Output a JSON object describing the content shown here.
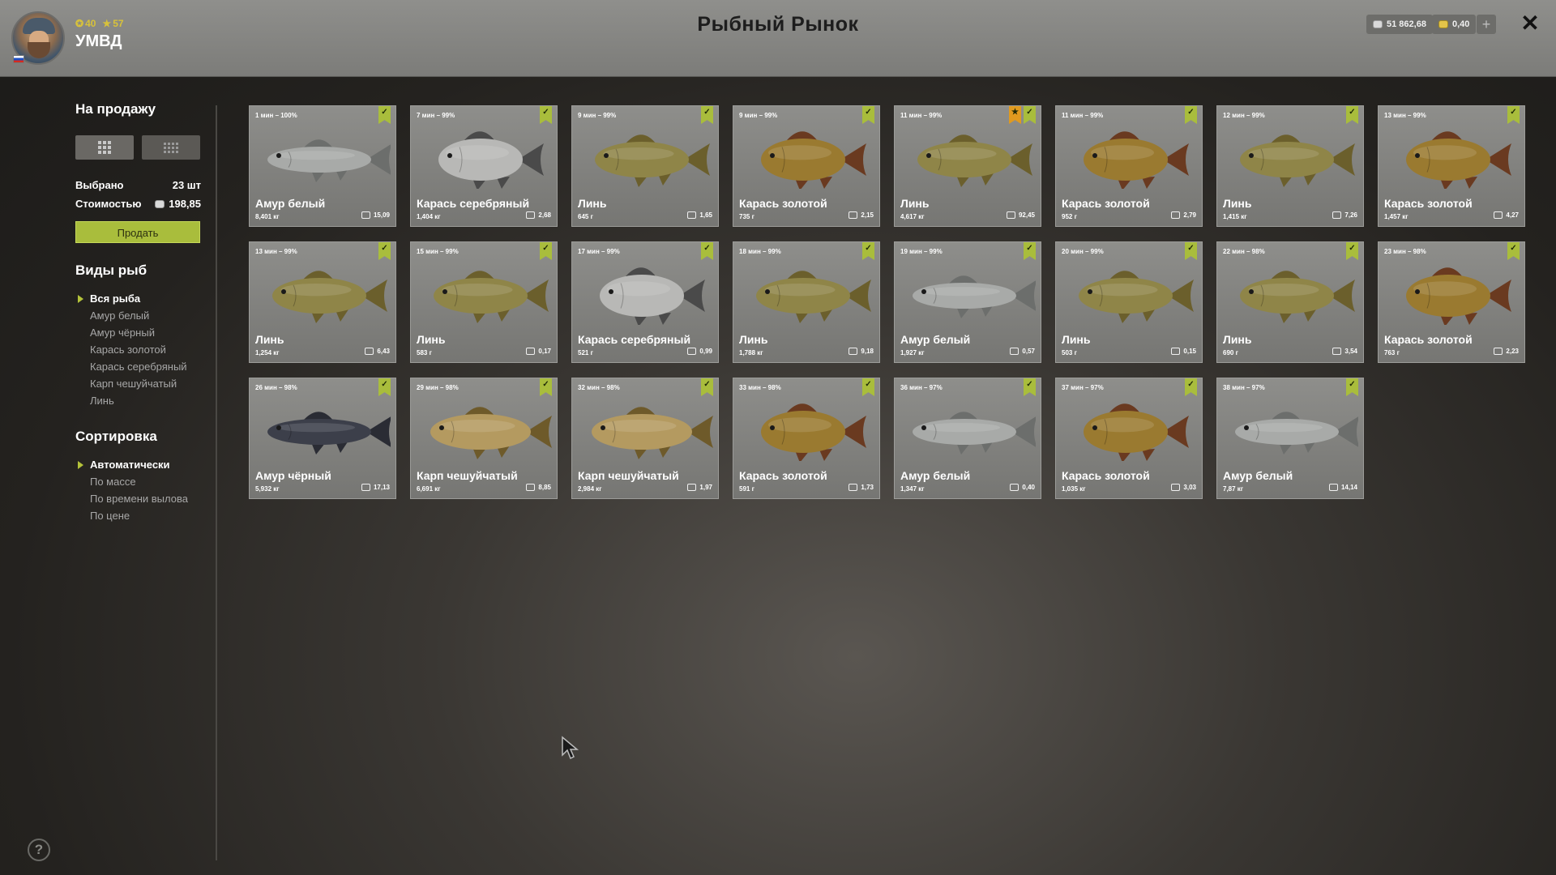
{
  "header": {
    "title": "Рыбный Рынок",
    "player": {
      "name": "УМВД",
      "stat1": "40",
      "stat2": "57"
    },
    "silver": "51 862,68",
    "gold": "0,40",
    "plus_label": "+",
    "close_label": "✕"
  },
  "sidebar": {
    "for_sale_title": "На продажу",
    "selected_label": "Выбрано",
    "selected_value": "23 шт",
    "cost_label": "Стоимостью",
    "cost_value": "198,85",
    "sell_label": "Продать",
    "species_title": "Виды рыб",
    "species": [
      {
        "label": "Вся рыба",
        "active": true
      },
      {
        "label": "Амур белый",
        "active": false
      },
      {
        "label": "Амур чёрный",
        "active": false
      },
      {
        "label": "Карась золотой",
        "active": false
      },
      {
        "label": "Карась серебряный",
        "active": false
      },
      {
        "label": "Карп чешуйчатый",
        "active": false
      },
      {
        "label": "Линь",
        "active": false
      }
    ],
    "sort_title": "Сортировка",
    "sort": [
      {
        "label": "Автоматически",
        "active": true
      },
      {
        "label": "По массе",
        "active": false
      },
      {
        "label": "По времени вылова",
        "active": false
      },
      {
        "label": "По цене",
        "active": false
      }
    ]
  },
  "help_label": "?",
  "fish": [
    {
      "time": "1 мин – 100%",
      "name": "Амур белый",
      "weight": "8,401 кг",
      "price": "15,09",
      "star": false
    },
    {
      "time": "7 мин – 99%",
      "name": "Карась серебряный",
      "weight": "1,404 кг",
      "price": "2,68",
      "star": false
    },
    {
      "time": "9 мин – 99%",
      "name": "Линь",
      "weight": "645 г",
      "price": "1,65",
      "star": false
    },
    {
      "time": "9 мин – 99%",
      "name": "Карась золотой",
      "weight": "735 г",
      "price": "2,15",
      "star": false
    },
    {
      "time": "11 мин – 99%",
      "name": "Линь",
      "weight": "4,617 кг",
      "price": "92,45",
      "star": true
    },
    {
      "time": "11 мин – 99%",
      "name": "Карась золотой",
      "weight": "952 г",
      "price": "2,79",
      "star": false
    },
    {
      "time": "12 мин – 99%",
      "name": "Линь",
      "weight": "1,415 кг",
      "price": "7,26",
      "star": false
    },
    {
      "time": "13 мин – 99%",
      "name": "Карась золотой",
      "weight": "1,457 кг",
      "price": "4,27",
      "star": false
    },
    {
      "time": "13 мин – 99%",
      "name": "Линь",
      "weight": "1,254 кг",
      "price": "6,43",
      "star": false
    },
    {
      "time": "15 мин – 99%",
      "name": "Линь",
      "weight": "583 г",
      "price": "0,17",
      "star": false
    },
    {
      "time": "17 мин – 99%",
      "name": "Карась серебряный",
      "weight": "521 г",
      "price": "0,99",
      "star": false
    },
    {
      "time": "18 мин – 99%",
      "name": "Линь",
      "weight": "1,788 кг",
      "price": "9,18",
      "star": false
    },
    {
      "time": "19 мин – 99%",
      "name": "Амур белый",
      "weight": "1,927 кг",
      "price": "0,57",
      "star": false
    },
    {
      "time": "20 мин – 99%",
      "name": "Линь",
      "weight": "503 г",
      "price": "0,15",
      "star": false
    },
    {
      "time": "22 мин – 98%",
      "name": "Линь",
      "weight": "690 г",
      "price": "3,54",
      "star": false
    },
    {
      "time": "23 мин – 98%",
      "name": "Карась золотой",
      "weight": "763 г",
      "price": "2,23",
      "star": false
    },
    {
      "time": "26 мин – 98%",
      "name": "Амур чёрный",
      "weight": "5,932 кг",
      "price": "17,13",
      "star": false
    },
    {
      "time": "29 мин – 98%",
      "name": "Карп чешуйчатый",
      "weight": "6,691 кг",
      "price": "8,85",
      "star": false
    },
    {
      "time": "32 мин – 98%",
      "name": "Карп чешуйчатый",
      "weight": "2,984 кг",
      "price": "1,97",
      "star": false
    },
    {
      "time": "33 мин – 98%",
      "name": "Карась золотой",
      "weight": "591 г",
      "price": "1,73",
      "star": false
    },
    {
      "time": "36 мин – 97%",
      "name": "Амур белый",
      "weight": "1,347 кг",
      "price": "0,40",
      "star": false
    },
    {
      "time": "37 мин – 97%",
      "name": "Карась золотой",
      "weight": "1,035 кг",
      "price": "3,03",
      "star": false
    },
    {
      "time": "38 мин – 97%",
      "name": "Амур белый",
      "weight": "7,87 кг",
      "price": "14,14",
      "star": false
    }
  ],
  "colors": {
    "accent": "#a9bd3c",
    "star": "#e09a1f",
    "amur_white": "#a8aaa8",
    "amur_black": "#3c3f4a",
    "tench": "#8f8548",
    "crucian_gold": "#9a7a30",
    "crucian_silver": "#b8b8b6",
    "carp": "#b49a60"
  }
}
